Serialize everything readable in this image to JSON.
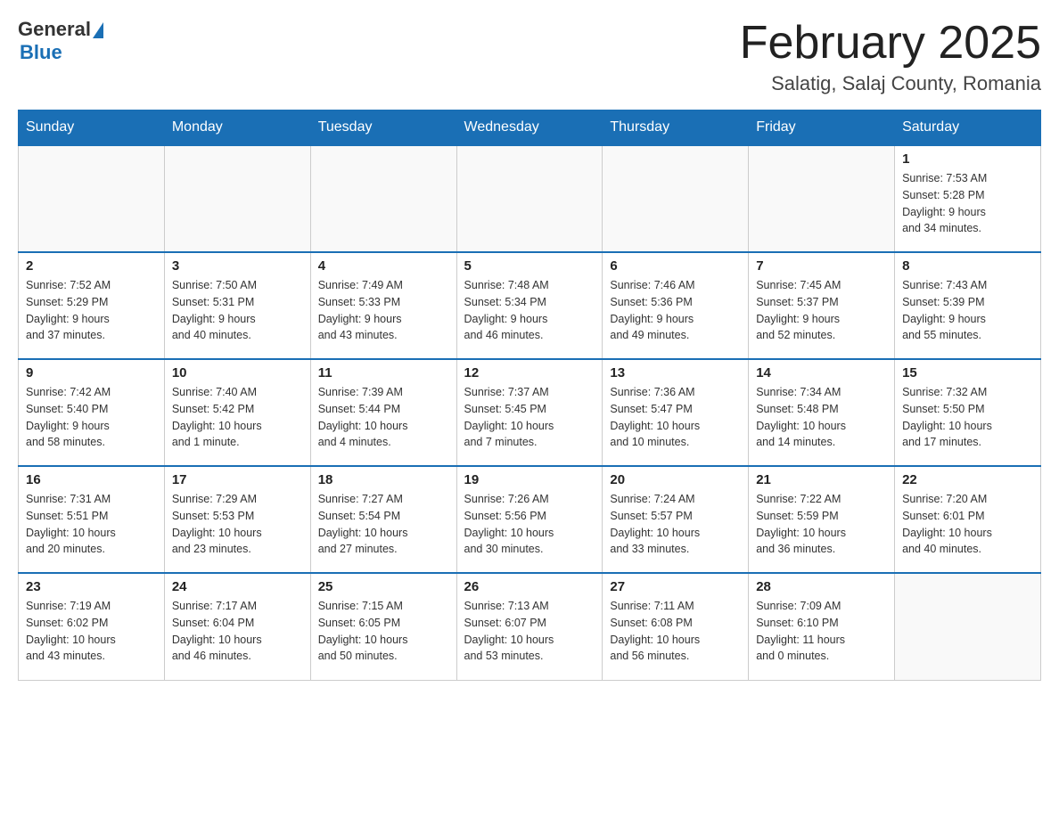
{
  "header": {
    "logo_general": "General",
    "logo_blue": "Blue",
    "title": "February 2025",
    "location": "Salatig, Salaj County, Romania"
  },
  "weekdays": [
    "Sunday",
    "Monday",
    "Tuesday",
    "Wednesday",
    "Thursday",
    "Friday",
    "Saturday"
  ],
  "weeks": [
    [
      {
        "day": "",
        "info": ""
      },
      {
        "day": "",
        "info": ""
      },
      {
        "day": "",
        "info": ""
      },
      {
        "day": "",
        "info": ""
      },
      {
        "day": "",
        "info": ""
      },
      {
        "day": "",
        "info": ""
      },
      {
        "day": "1",
        "info": "Sunrise: 7:53 AM\nSunset: 5:28 PM\nDaylight: 9 hours\nand 34 minutes."
      }
    ],
    [
      {
        "day": "2",
        "info": "Sunrise: 7:52 AM\nSunset: 5:29 PM\nDaylight: 9 hours\nand 37 minutes."
      },
      {
        "day": "3",
        "info": "Sunrise: 7:50 AM\nSunset: 5:31 PM\nDaylight: 9 hours\nand 40 minutes."
      },
      {
        "day": "4",
        "info": "Sunrise: 7:49 AM\nSunset: 5:33 PM\nDaylight: 9 hours\nand 43 minutes."
      },
      {
        "day": "5",
        "info": "Sunrise: 7:48 AM\nSunset: 5:34 PM\nDaylight: 9 hours\nand 46 minutes."
      },
      {
        "day": "6",
        "info": "Sunrise: 7:46 AM\nSunset: 5:36 PM\nDaylight: 9 hours\nand 49 minutes."
      },
      {
        "day": "7",
        "info": "Sunrise: 7:45 AM\nSunset: 5:37 PM\nDaylight: 9 hours\nand 52 minutes."
      },
      {
        "day": "8",
        "info": "Sunrise: 7:43 AM\nSunset: 5:39 PM\nDaylight: 9 hours\nand 55 minutes."
      }
    ],
    [
      {
        "day": "9",
        "info": "Sunrise: 7:42 AM\nSunset: 5:40 PM\nDaylight: 9 hours\nand 58 minutes."
      },
      {
        "day": "10",
        "info": "Sunrise: 7:40 AM\nSunset: 5:42 PM\nDaylight: 10 hours\nand 1 minute."
      },
      {
        "day": "11",
        "info": "Sunrise: 7:39 AM\nSunset: 5:44 PM\nDaylight: 10 hours\nand 4 minutes."
      },
      {
        "day": "12",
        "info": "Sunrise: 7:37 AM\nSunset: 5:45 PM\nDaylight: 10 hours\nand 7 minutes."
      },
      {
        "day": "13",
        "info": "Sunrise: 7:36 AM\nSunset: 5:47 PM\nDaylight: 10 hours\nand 10 minutes."
      },
      {
        "day": "14",
        "info": "Sunrise: 7:34 AM\nSunset: 5:48 PM\nDaylight: 10 hours\nand 14 minutes."
      },
      {
        "day": "15",
        "info": "Sunrise: 7:32 AM\nSunset: 5:50 PM\nDaylight: 10 hours\nand 17 minutes."
      }
    ],
    [
      {
        "day": "16",
        "info": "Sunrise: 7:31 AM\nSunset: 5:51 PM\nDaylight: 10 hours\nand 20 minutes."
      },
      {
        "day": "17",
        "info": "Sunrise: 7:29 AM\nSunset: 5:53 PM\nDaylight: 10 hours\nand 23 minutes."
      },
      {
        "day": "18",
        "info": "Sunrise: 7:27 AM\nSunset: 5:54 PM\nDaylight: 10 hours\nand 27 minutes."
      },
      {
        "day": "19",
        "info": "Sunrise: 7:26 AM\nSunset: 5:56 PM\nDaylight: 10 hours\nand 30 minutes."
      },
      {
        "day": "20",
        "info": "Sunrise: 7:24 AM\nSunset: 5:57 PM\nDaylight: 10 hours\nand 33 minutes."
      },
      {
        "day": "21",
        "info": "Sunrise: 7:22 AM\nSunset: 5:59 PM\nDaylight: 10 hours\nand 36 minutes."
      },
      {
        "day": "22",
        "info": "Sunrise: 7:20 AM\nSunset: 6:01 PM\nDaylight: 10 hours\nand 40 minutes."
      }
    ],
    [
      {
        "day": "23",
        "info": "Sunrise: 7:19 AM\nSunset: 6:02 PM\nDaylight: 10 hours\nand 43 minutes."
      },
      {
        "day": "24",
        "info": "Sunrise: 7:17 AM\nSunset: 6:04 PM\nDaylight: 10 hours\nand 46 minutes."
      },
      {
        "day": "25",
        "info": "Sunrise: 7:15 AM\nSunset: 6:05 PM\nDaylight: 10 hours\nand 50 minutes."
      },
      {
        "day": "26",
        "info": "Sunrise: 7:13 AM\nSunset: 6:07 PM\nDaylight: 10 hours\nand 53 minutes."
      },
      {
        "day": "27",
        "info": "Sunrise: 7:11 AM\nSunset: 6:08 PM\nDaylight: 10 hours\nand 56 minutes."
      },
      {
        "day": "28",
        "info": "Sunrise: 7:09 AM\nSunset: 6:10 PM\nDaylight: 11 hours\nand 0 minutes."
      },
      {
        "day": "",
        "info": ""
      }
    ]
  ]
}
